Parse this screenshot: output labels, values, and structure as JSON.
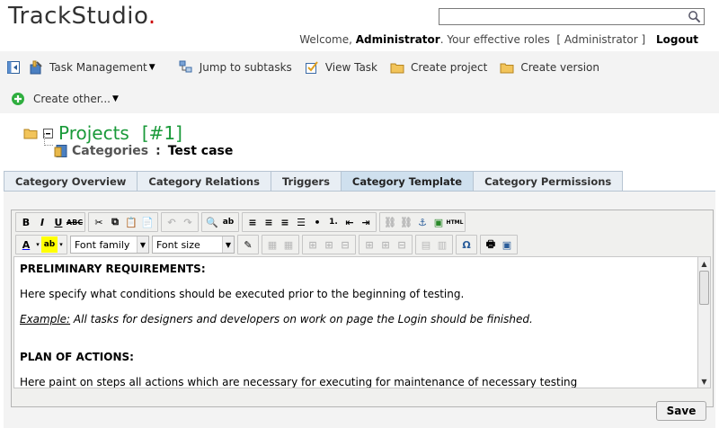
{
  "app": {
    "logo_text": "TrackStudio",
    "logo_dot": "."
  },
  "search": {
    "placeholder": "",
    "value": ""
  },
  "user_bar": {
    "welcome": "Welcome,",
    "user": "Administrator",
    "roles_text": ". Your effective roles",
    "roles": "[ Administrator ]",
    "logout": "Logout"
  },
  "toolbar": {
    "task_management": "Task Management",
    "jump_to_subtasks": "Jump to subtasks",
    "view_task": "View Task",
    "create_project": "Create project",
    "create_version": "Create version",
    "create_other": "Create other..."
  },
  "breadcrumb": {
    "projects": "Projects",
    "projects_num": "[#1]",
    "categories_label": "Categories",
    "separator": ":",
    "category_name": "Test case"
  },
  "tabs": [
    {
      "label": "Category Overview",
      "active": false
    },
    {
      "label": "Category Relations",
      "active": false
    },
    {
      "label": "Triggers",
      "active": false
    },
    {
      "label": "Category Template",
      "active": true
    },
    {
      "label": "Category Permissions",
      "active": false
    }
  ],
  "editor": {
    "font_family": "Font family",
    "font_size": "Font size",
    "content": {
      "h1": "PRELIMINARY REQUIREMENTS:",
      "p1": "Here specify what conditions should be executed prior to the beginning of testing.",
      "ex_label": "Example:",
      "ex_text": " All tasks for designers and developers on work on page the Login should be finished.",
      "h2": "PLAN OF ACTIONS:",
      "p2": "Here paint on steps all actions which are necessary for executing for maintenance of necessary testing"
    }
  },
  "save_button": "Save",
  "colors": {
    "accent_green": "#1a9a3a",
    "tab_active": "#cfe0ee",
    "tab_bg": "#e8eef4",
    "logo_dot": "#cc0000"
  }
}
